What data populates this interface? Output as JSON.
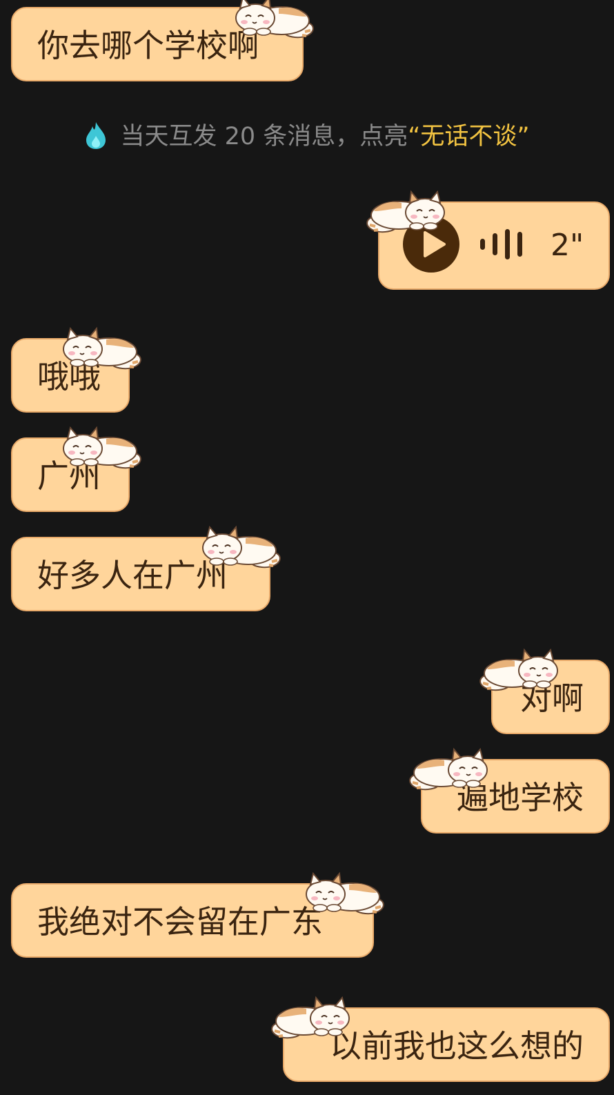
{
  "notice": {
    "prefix": "当天互发 20 条消息，点亮",
    "highlight": "“无话不谈”"
  },
  "messages": [
    {
      "side": "left",
      "type": "text",
      "text": "你去哪个学校啊"
    },
    {
      "side": "right",
      "type": "voice",
      "duration": "2\""
    },
    {
      "side": "left",
      "type": "text",
      "text": "哦哦"
    },
    {
      "side": "left",
      "type": "text",
      "text": "广州"
    },
    {
      "side": "left",
      "type": "text",
      "text": "好多人在广州"
    },
    {
      "side": "right",
      "type": "text",
      "text": "对啊"
    },
    {
      "side": "right",
      "type": "text",
      "text": "遍地学校"
    },
    {
      "side": "left",
      "type": "text",
      "text": "我绝对不会留在广东"
    },
    {
      "side": "right",
      "type": "text",
      "text": "以前我也这么想的"
    }
  ],
  "colors": {
    "background": "#161616",
    "bubble_fill": "#ffd59b",
    "bubble_border": "#e9aa6a",
    "bubble_text": "#3a2410",
    "notice_text": "#8a8a8a",
    "notice_highlight": "#f2c341",
    "flame": "#3ec6d6"
  },
  "icons": {
    "flame": "flame-icon",
    "play": "play-icon",
    "waveform": "waveform-icon",
    "bubble_decoration": "cat-icon"
  }
}
